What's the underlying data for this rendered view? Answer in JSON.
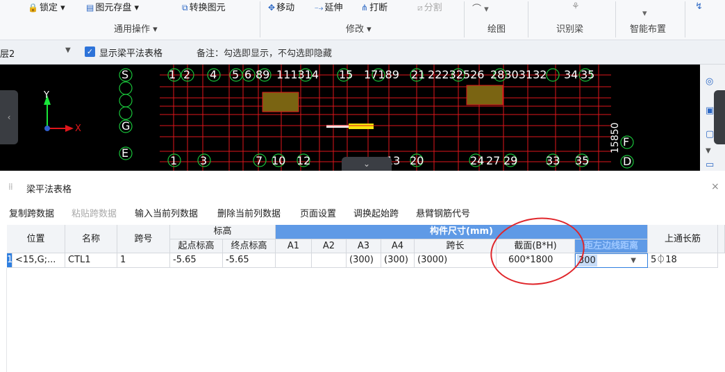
{
  "ribbon": {
    "items": [
      {
        "label": "锁定 ▾",
        "icon": "lock-icon"
      },
      {
        "label": "图元存盘 ▾",
        "icon": "save-element-icon"
      },
      {
        "label": "转换图元",
        "icon": "convert-icon"
      },
      {
        "label": "移动",
        "icon": "move-icon"
      },
      {
        "label": "延伸",
        "icon": "extend-icon"
      },
      {
        "label": "打断",
        "icon": "break-icon"
      },
      {
        "label": "分割",
        "icon": "split-icon"
      }
    ],
    "groups": [
      "通用操作 ▾",
      "修改 ▾",
      "绘图",
      "识别梁",
      "智能布置"
    ]
  },
  "layerbar": {
    "layer": "层2",
    "show_table_label": "显示梁平法表格",
    "note": "备注：勾选即显示，不勾选即隐藏"
  },
  "cad": {
    "axis_top": [
      "1",
      "2",
      "4",
      "5",
      "6",
      "89",
      "111314",
      "15",
      "17189",
      "21",
      "22232526",
      "28303132",
      "34",
      "35"
    ],
    "axis_bottom": [
      "1",
      "3",
      "7",
      "10",
      "12",
      "13",
      "20",
      "24",
      "27",
      "29",
      "33",
      "35"
    ],
    "left_letters": [
      "S",
      "G",
      "E"
    ],
    "right_letters": [
      "F",
      "D"
    ],
    "dim_text": "15850",
    "x_label": "X",
    "y_label": "Y"
  },
  "panel": {
    "title": "梁平法表格",
    "toolbar": [
      "复制跨数据",
      "粘贴跨数据",
      "输入当前列数据",
      "删除当前列数据",
      "页面设置",
      "调换起始跨",
      "悬臂钢筋代号"
    ]
  },
  "table": {
    "headers": {
      "position": "位置",
      "name": "名称",
      "span_no": "跨号",
      "elevation": "标高",
      "start_elev": "起点标高",
      "end_elev": "终点标高",
      "dims": "构件尺寸(mm)",
      "a1": "A1",
      "a2": "A2",
      "a3": "A3",
      "a4": "A4",
      "span_len": "跨长",
      "section": "截面(B*H)",
      "left_dist": "距左边线距离",
      "top_rebar": "上通长筋"
    },
    "row": {
      "num": "1",
      "position": "<15,G;...",
      "name": "CTL1",
      "span_no": "1",
      "start_elev": "-5.65",
      "end_elev": "-5.65",
      "a1": "",
      "a2": "",
      "a3": "(300)",
      "a4": "(300)",
      "span_len": "(3000)",
      "section": "600*1800",
      "left_dist": "300",
      "top_rebar": "5⏀18"
    }
  },
  "colors": {
    "accent": "#2f7fe0",
    "annotation": "#e0252a",
    "cad_bg": "#000000",
    "grid_green": "#19c43a",
    "grid_red": "#e0161b"
  }
}
